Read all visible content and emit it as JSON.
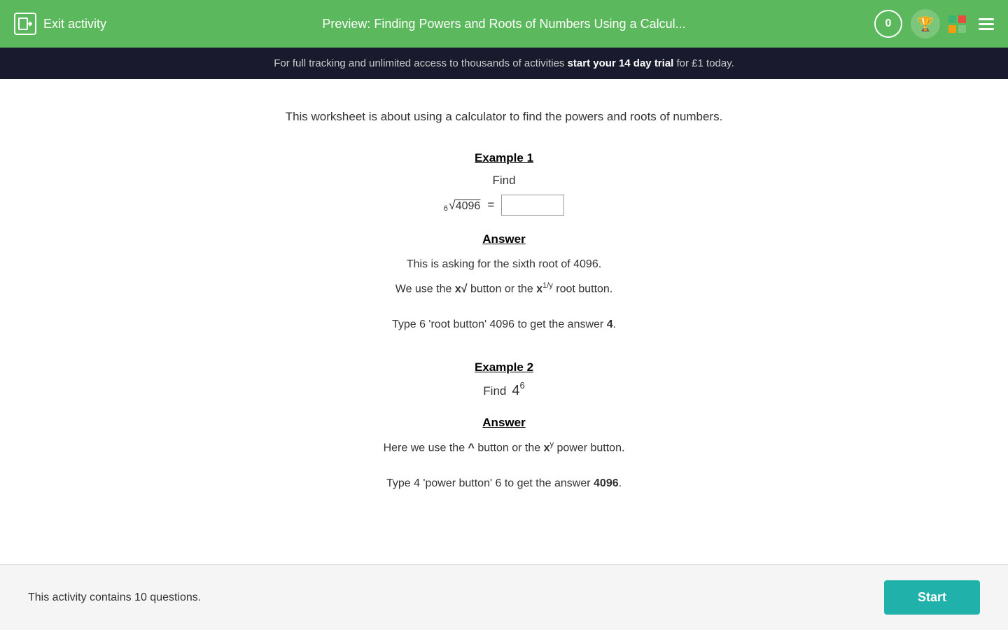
{
  "header": {
    "exit_label": "Exit activity",
    "title": "Preview: Finding Powers and Roots of Numbers Using a Calcul...",
    "score": "0",
    "colors": {
      "header_bg": "#5cb85c",
      "banner_bg": "#1a1a2e"
    }
  },
  "banner": {
    "text_normal": "For full tracking and unlimited access to thousands of activities ",
    "text_bold": "start your 14 day trial",
    "text_after": " for £1 today."
  },
  "content": {
    "intro": "This worksheet is about using a calculator to find the powers and roots of numbers.",
    "example1": {
      "title": "Example 1",
      "find_label": "Find",
      "math_expression": "⁶√4096 =",
      "input_placeholder": "",
      "answer": {
        "title": "Answer",
        "line1": "This is asking for the sixth root of 4096.",
        "line2_prefix": "We use the ",
        "line2_button1": "x√",
        "line2_mid": " button or the ",
        "line2_button2": "x",
        "line2_sup": "1/y",
        "line2_suffix": " root button.",
        "spacer": "",
        "line3_prefix": "Type 6 'root button' 4096 to get the answer ",
        "line3_answer": "4",
        "line3_suffix": "."
      }
    },
    "example2": {
      "title": "Example 2",
      "find_label": "Find",
      "power_base": "4",
      "power_exp": "6",
      "answer": {
        "title": "Answer",
        "line1_prefix": "Here we use the ",
        "line1_button1": "^",
        "line1_mid": " button or the ",
        "line1_button2": "x",
        "line1_sup": "y",
        "line1_suffix": " power button.",
        "spacer": "",
        "line2_prefix": "Type 4 'power button' 6 to get the answer ",
        "line2_answer": "4096",
        "line2_suffix": "."
      }
    }
  },
  "bottom": {
    "text": "This activity contains 10 questions.",
    "start_label": "Start"
  }
}
